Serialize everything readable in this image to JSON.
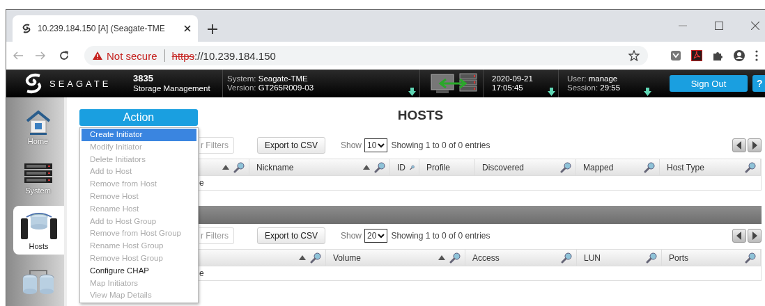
{
  "browser": {
    "tab_title": "10.239.184.150 [A] (Seagate-TME",
    "security": "Not secure",
    "url_scheme": "https",
    "url_rest": "://10.239.184.150"
  },
  "header": {
    "brand": "SEAGATE",
    "model": "3835",
    "product": "Storage Management",
    "system_label": "System:",
    "system_value": "Seagate-TME",
    "version_label": "Version:",
    "version_value": "GT265R009-03",
    "date": "2020-09-21",
    "time": "17:05:45",
    "user_label": "User:",
    "user_value": "manage",
    "session_label": "Session:",
    "session_value": "29:55",
    "sign_out": "Sign Out",
    "help": "?"
  },
  "sidebar": {
    "items": [
      {
        "kind": "home",
        "label": "Home",
        "selected": false
      },
      {
        "kind": "system",
        "label": "System",
        "selected": false
      },
      {
        "kind": "hosts",
        "label": "Hosts",
        "selected": true
      },
      {
        "kind": "pools",
        "selected": false
      }
    ]
  },
  "action_button": "Action",
  "action_menu": [
    {
      "label": "Create Initiator",
      "selected": true,
      "disabled": false
    },
    {
      "label": "Modify Initiator",
      "selected": false,
      "disabled": true
    },
    {
      "label": "Delete Initiators",
      "selected": false,
      "disabled": true
    },
    {
      "label": "Add to Host",
      "selected": false,
      "disabled": true
    },
    {
      "label": "Remove from Host",
      "selected": false,
      "disabled": true
    },
    {
      "label": "Remove Host",
      "selected": false,
      "disabled": true
    },
    {
      "label": "Rename Host",
      "selected": false,
      "disabled": true
    },
    {
      "label": "Add to Host Group",
      "selected": false,
      "disabled": true
    },
    {
      "label": "Remove from Host Group",
      "selected": false,
      "disabled": true
    },
    {
      "label": "Rename Host Group",
      "selected": false,
      "disabled": true
    },
    {
      "label": "Remove Host Group",
      "selected": false,
      "disabled": true
    },
    {
      "label": "Configure CHAP",
      "selected": false,
      "disabled": false
    },
    {
      "label": "Map Initiators",
      "selected": false,
      "disabled": true
    },
    {
      "label": "View Map Details",
      "selected": false,
      "disabled": true
    }
  ],
  "page_title": "HOSTS",
  "tables": [
    {
      "filters_button": "r Filters",
      "export_button": "Export to CSV",
      "show_label": "Show",
      "page_size": "10",
      "info": "Showing 1 to 0 of 0 entries",
      "row_fragment": "e",
      "columns": [
        {
          "sortable": true,
          "searchable": true
        },
        {
          "label": "Nickname",
          "sortable": true,
          "searchable": true
        },
        {
          "label": "ID",
          "sortable": false,
          "searchable": true
        },
        {
          "label": "Profile",
          "sortable": false,
          "searchable": false
        },
        {
          "label": "Discovered",
          "sortable": false,
          "searchable": true
        },
        {
          "label": "Mapped",
          "sortable": false,
          "searchable": true
        },
        {
          "label": "Host Type",
          "sortable": false,
          "searchable": true
        }
      ]
    },
    {
      "filters_button": "r Filters",
      "export_button": "Export to CSV",
      "show_label": "Show",
      "page_size": "20",
      "info": "Showing 1 to 0 of 0 entries",
      "row_fragment": "e",
      "columns": [
        {
          "sortable": true,
          "searchable": true
        },
        {
          "label": "Volume",
          "sortable": true,
          "searchable": true
        },
        {
          "label": "Access",
          "sortable": false,
          "searchable": true
        },
        {
          "label": "LUN",
          "sortable": false,
          "searchable": true
        },
        {
          "label": "Ports",
          "sortable": false,
          "searchable": true
        }
      ]
    }
  ]
}
